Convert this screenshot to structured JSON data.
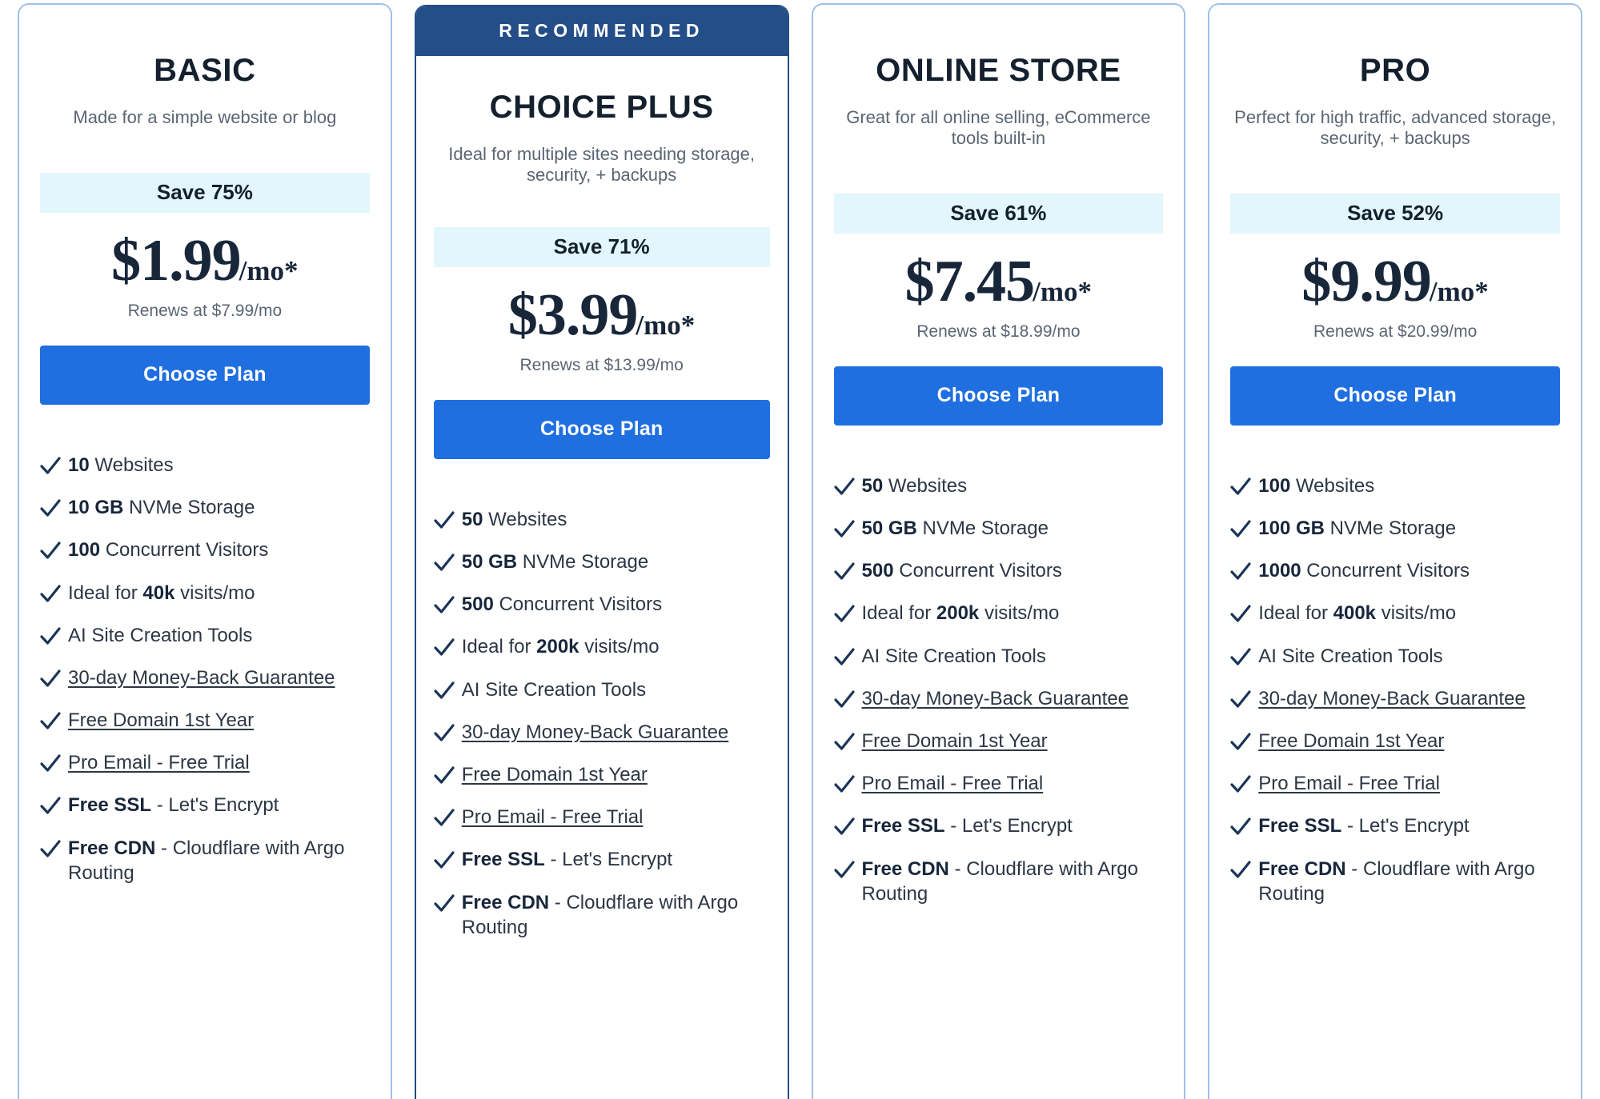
{
  "colors": {
    "accent_button": "#1F6FE0",
    "recommended_banner": "#234E88",
    "save_badge_bg": "#E2F6FB",
    "card_border": "#9FC0E8",
    "card_border_recommended": "#234E88",
    "heading_text": "#14202E",
    "body_text": "#5B6573"
  },
  "common": {
    "choose_plan_label": "Choose Plan",
    "recommended_label": "RECOMMENDED",
    "check_icon": "check-icon"
  },
  "plans": [
    {
      "id": "basic",
      "name": "BASIC",
      "tagline": "Made for a simple website or blog",
      "recommended": false,
      "save_label": "Save 75%",
      "price_amount": "$1.99",
      "price_period": "/mo*",
      "renews": "Renews at $7.99/mo",
      "cta": "Choose Plan",
      "features": [
        {
          "bold": "10",
          "text": " Websites",
          "link": false
        },
        {
          "bold": "10 GB",
          "text": " NVMe Storage",
          "link": false
        },
        {
          "bold": "100",
          "text": " Concurrent Visitors",
          "link": false
        },
        {
          "pre": "Ideal for ",
          "bold": "40k",
          "text": " visits/mo",
          "link": false
        },
        {
          "text": "AI Site Creation Tools",
          "link": false
        },
        {
          "text": "30-day Money-Back Guarantee",
          "link": true
        },
        {
          "text": "Free Domain 1st Year",
          "link": true
        },
        {
          "text": "Pro Email - Free Trial",
          "link": true
        },
        {
          "bold": "Free SSL",
          "text": " - Let's Encrypt",
          "link": false
        },
        {
          "bold": "Free CDN",
          "text": " - Cloudflare with Argo Routing",
          "link": false
        }
      ]
    },
    {
      "id": "choice-plus",
      "name": "CHOICE PLUS",
      "tagline": "Ideal for multiple sites needing storage, security, + backups",
      "recommended": true,
      "save_label": "Save 71%",
      "price_amount": "$3.99",
      "price_period": "/mo*",
      "renews": "Renews at $13.99/mo",
      "cta": "Choose Plan",
      "features": [
        {
          "bold": "50",
          "text": " Websites",
          "link": false
        },
        {
          "bold": "50 GB",
          "text": " NVMe Storage",
          "link": false
        },
        {
          "bold": "500",
          "text": " Concurrent Visitors",
          "link": false
        },
        {
          "pre": "Ideal for ",
          "bold": "200k",
          "text": " visits/mo",
          "link": false
        },
        {
          "text": "AI Site Creation Tools",
          "link": false
        },
        {
          "text": "30-day Money-Back Guarantee",
          "link": true
        },
        {
          "text": "Free Domain 1st Year",
          "link": true
        },
        {
          "text": "Pro Email - Free Trial",
          "link": true
        },
        {
          "bold": "Free SSL",
          "text": " - Let's Encrypt",
          "link": false
        },
        {
          "bold": "Free CDN",
          "text": " - Cloudflare with Argo Routing",
          "link": false
        }
      ]
    },
    {
      "id": "online-store",
      "name": "ONLINE STORE",
      "tagline": "Great for all online selling, eCommerce tools built-in",
      "recommended": false,
      "save_label": "Save 61%",
      "price_amount": "$7.45",
      "price_period": "/mo*",
      "renews": "Renews at $18.99/mo",
      "cta": "Choose Plan",
      "features": [
        {
          "bold": "50",
          "text": " Websites",
          "link": false
        },
        {
          "bold": "50 GB",
          "text": " NVMe Storage",
          "link": false
        },
        {
          "bold": "500",
          "text": " Concurrent Visitors",
          "link": false
        },
        {
          "pre": "Ideal for ",
          "bold": "200k",
          "text": " visits/mo",
          "link": false
        },
        {
          "text": "AI Site Creation Tools",
          "link": false
        },
        {
          "text": "30-day Money-Back Guarantee",
          "link": true
        },
        {
          "text": "Free Domain 1st Year",
          "link": true
        },
        {
          "text": "Pro Email - Free Trial",
          "link": true
        },
        {
          "bold": "Free SSL",
          "text": " - Let's Encrypt",
          "link": false
        },
        {
          "bold": "Free CDN",
          "text": " - Cloudflare with Argo Routing",
          "link": false
        }
      ]
    },
    {
      "id": "pro",
      "name": "PRO",
      "tagline": "Perfect for high traffic, advanced storage, security, + backups",
      "recommended": false,
      "save_label": "Save 52%",
      "price_amount": "$9.99",
      "price_period": "/mo*",
      "renews": "Renews at $20.99/mo",
      "cta": "Choose Plan",
      "features": [
        {
          "bold": "100",
          "text": " Websites",
          "link": false
        },
        {
          "bold": "100 GB",
          "text": " NVMe Storage",
          "link": false
        },
        {
          "bold": "1000",
          "text": " Concurrent Visitors",
          "link": false
        },
        {
          "pre": "Ideal for ",
          "bold": "400k",
          "text": " visits/mo",
          "link": false
        },
        {
          "text": "AI Site Creation Tools",
          "link": false
        },
        {
          "text": "30-day Money-Back Guarantee",
          "link": true
        },
        {
          "text": "Free Domain 1st Year",
          "link": true
        },
        {
          "text": "Pro Email - Free Trial",
          "link": true
        },
        {
          "bold": "Free SSL",
          "text": " - Let's Encrypt",
          "link": false
        },
        {
          "bold": "Free CDN",
          "text": " - Cloudflare with Argo Routing",
          "link": false
        }
      ]
    }
  ]
}
